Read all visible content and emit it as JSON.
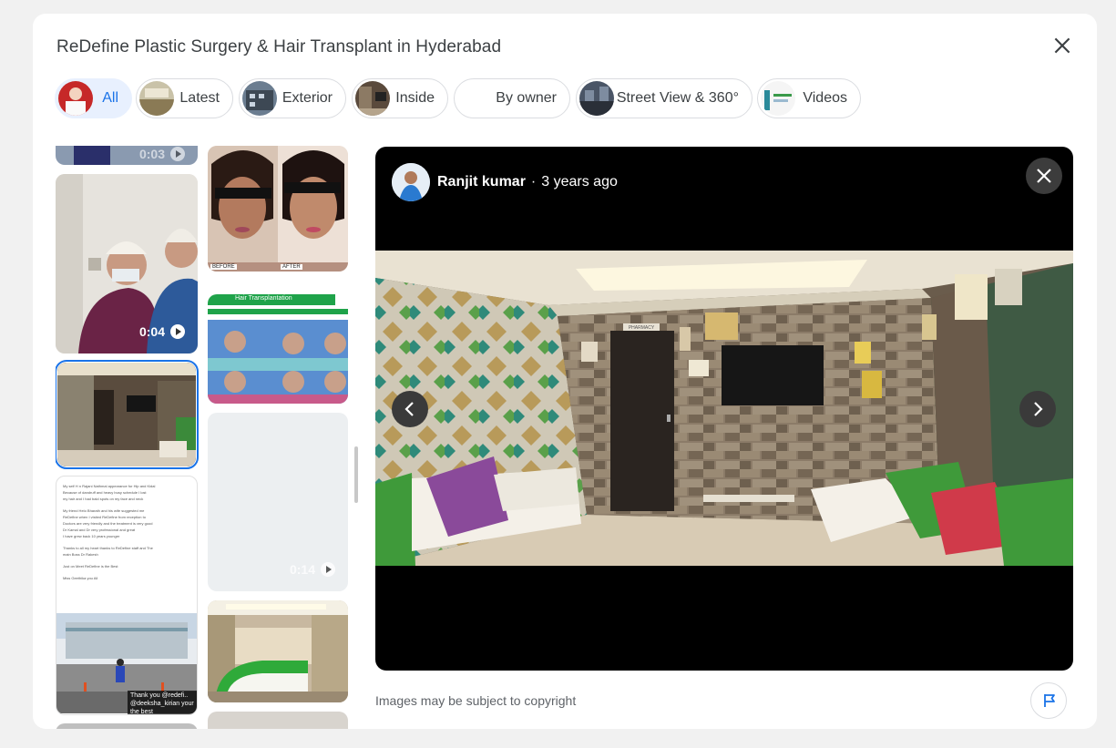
{
  "header": {
    "title": "ReDefine Plastic Surgery & Hair Transplant in Hyderabad"
  },
  "filters": [
    {
      "label": "All",
      "active": true
    },
    {
      "label": "Latest",
      "active": false
    },
    {
      "label": "Exterior",
      "active": false
    },
    {
      "label": "Inside",
      "active": false
    },
    {
      "label": "By owner",
      "active": false
    },
    {
      "label": "Street View & 360°",
      "active": false
    },
    {
      "label": "Videos",
      "active": false
    }
  ],
  "gallery": {
    "tiles": [
      {
        "kind": "video",
        "duration": "0:03"
      },
      {
        "kind": "video",
        "duration": "0:04"
      },
      {
        "kind": "photo",
        "selected": true
      },
      {
        "kind": "photo",
        "note_lines": [
          "My self H n Rajani Nathmal appearance for Hip and Kidal",
          "Because of dandruff and heavy busy schedule I lost",
          "my hair and I had bald spots on my face and neck",
          "My friend Helo Bharath and his wife suggested me",
          "ReDefine when I visited ReDefine from reception to",
          "Doctors are very friendly and the treatment is very good",
          "Dr Kamal and Dr very professional and great",
          "I have grew back 10 years younger",
          "Thanks to all my heart thanks to ReDefine staff and The",
          "main Boss Dr Rakesh",
          "Just on Meet ReDefine is the Best",
          "Miss Geethika you All"
        ],
        "overlay_text": [
          "Thank you @redefi..",
          "@deeksha_kirian your the best"
        ]
      },
      {
        "kind": "photo",
        "before_label": "BEFORE",
        "after_label": "AFTER"
      },
      {
        "kind": "photo",
        "banner_text": "Hair Transplantation"
      },
      {
        "kind": "video",
        "duration": "0:14"
      },
      {
        "kind": "photo"
      }
    ]
  },
  "viewer": {
    "author": "Ranjit kumar",
    "separator": "·",
    "time": "3 years ago",
    "sign_text": "PHARMACY"
  },
  "footer": {
    "copyright": "Images may be subject to copyright"
  },
  "icons": {
    "close": "close-icon",
    "prev": "chevron-left-icon",
    "next": "chevron-right-icon",
    "flag": "flag-icon",
    "play": "play-icon"
  },
  "colors": {
    "accent": "#1a73e8",
    "chip_active_bg": "#e8f0fe"
  }
}
